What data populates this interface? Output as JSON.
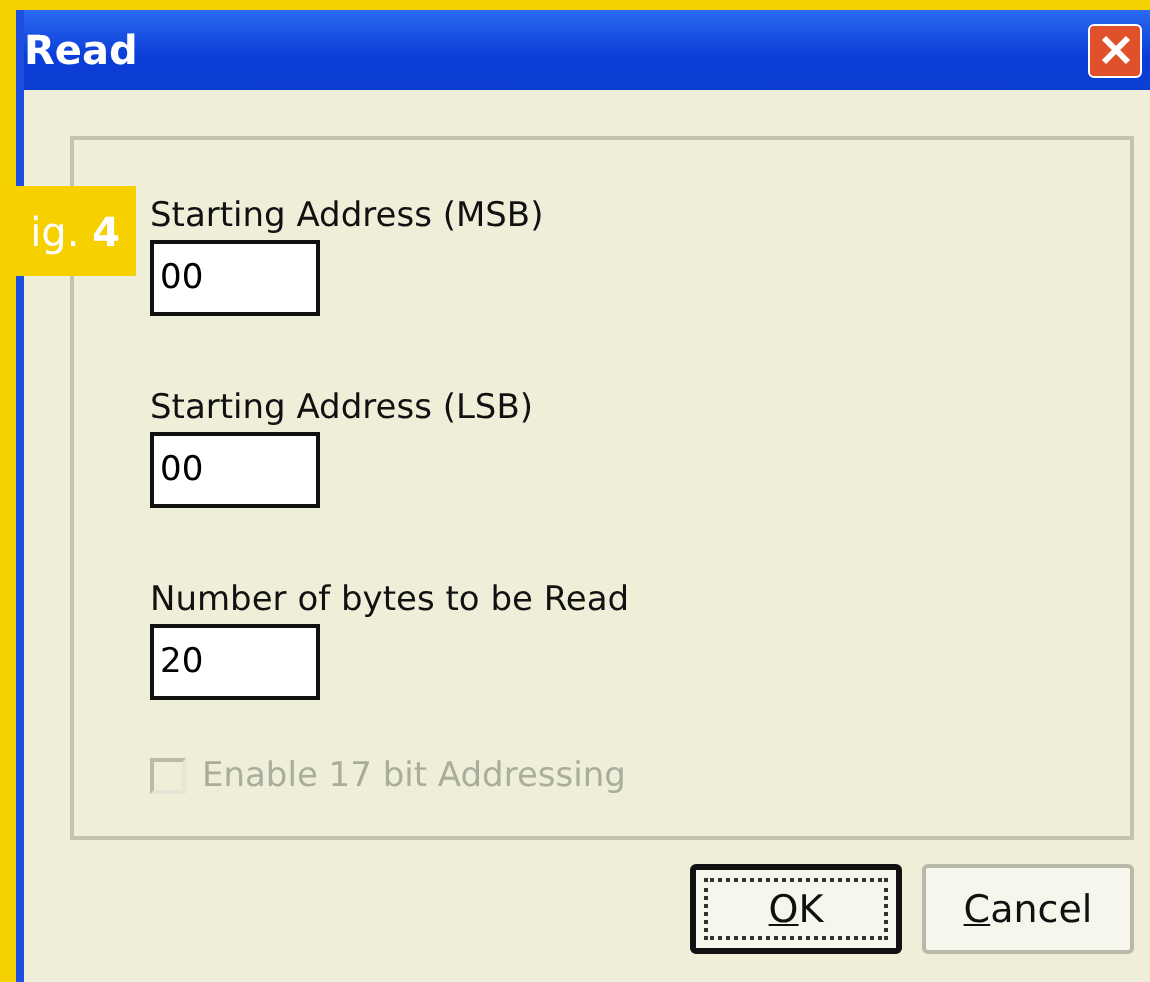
{
  "window": {
    "title": "Read"
  },
  "figure_label": {
    "text": "ig. **4**"
  },
  "fields": [
    {
      "label": "Starting Address (MSB)",
      "value": "00"
    },
    {
      "label": "Starting Address (LSB)",
      "value": "00"
    },
    {
      "label": "Number of bytes to be Read",
      "value": "20"
    }
  ],
  "checkbox": {
    "label": "Enable 17 bit Addressing",
    "checked": false,
    "disabled": true
  },
  "buttons": [
    {
      "label": "OK",
      "default": true,
      "underline_first": true
    },
    {
      "label": "Cancel",
      "default": false,
      "underline_first": true
    }
  ]
}
